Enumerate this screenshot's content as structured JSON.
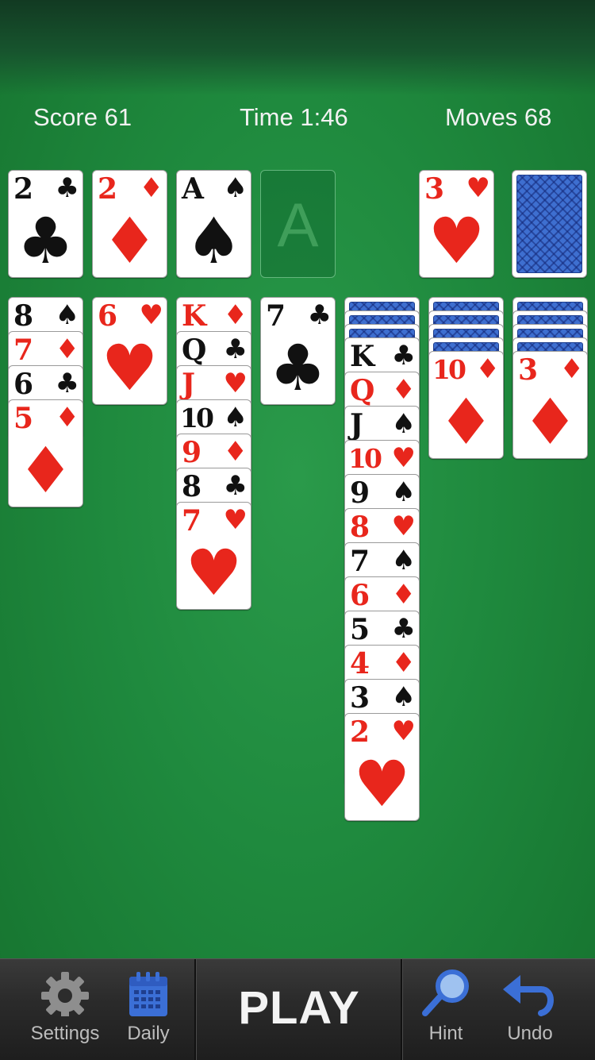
{
  "stats": {
    "score": "Score 61",
    "time": "Time 1:46",
    "moves": "Moves 68"
  },
  "foundations": [
    {
      "rank": "2",
      "suit": "♣",
      "color": "black"
    },
    {
      "rank": "2",
      "suit": "♦",
      "color": "red"
    },
    {
      "rank": "A",
      "suit": "♠",
      "color": "black"
    },
    {
      "empty": true,
      "placeholder": "A"
    }
  ],
  "waste": {
    "rank": "3",
    "suit": "♥",
    "color": "red"
  },
  "stock": {
    "face_down": true
  },
  "tableau": [
    {
      "hidden": 0,
      "cards": [
        {
          "rank": "8",
          "suit": "♠",
          "color": "black"
        },
        {
          "rank": "7",
          "suit": "♦",
          "color": "red"
        },
        {
          "rank": "6",
          "suit": "♣",
          "color": "black"
        },
        {
          "rank": "5",
          "suit": "♦",
          "color": "red"
        }
      ]
    },
    {
      "hidden": 0,
      "cards": [
        {
          "rank": "6",
          "suit": "♥",
          "color": "red"
        }
      ]
    },
    {
      "hidden": 0,
      "cards": [
        {
          "rank": "K",
          "suit": "♦",
          "color": "red"
        },
        {
          "rank": "Q",
          "suit": "♣",
          "color": "black"
        },
        {
          "rank": "J",
          "suit": "♥",
          "color": "red"
        },
        {
          "rank": "10",
          "suit": "♠",
          "color": "black"
        },
        {
          "rank": "9",
          "suit": "♦",
          "color": "red"
        },
        {
          "rank": "8",
          "suit": "♣",
          "color": "black"
        },
        {
          "rank": "7",
          "suit": "♥",
          "color": "red"
        }
      ]
    },
    {
      "hidden": 0,
      "cards": [
        {
          "rank": "7",
          "suit": "♣",
          "color": "black"
        }
      ]
    },
    {
      "hidden": 3,
      "cards": [
        {
          "rank": "K",
          "suit": "♣",
          "color": "black"
        },
        {
          "rank": "Q",
          "suit": "♦",
          "color": "red"
        },
        {
          "rank": "J",
          "suit": "♠",
          "color": "black"
        },
        {
          "rank": "10",
          "suit": "♥",
          "color": "red"
        },
        {
          "rank": "9",
          "suit": "♠",
          "color": "black"
        },
        {
          "rank": "8",
          "suit": "♥",
          "color": "red"
        },
        {
          "rank": "7",
          "suit": "♠",
          "color": "black"
        },
        {
          "rank": "6",
          "suit": "♦",
          "color": "red"
        },
        {
          "rank": "5",
          "suit": "♣",
          "color": "black"
        },
        {
          "rank": "4",
          "suit": "♦",
          "color": "red"
        },
        {
          "rank": "3",
          "suit": "♠",
          "color": "black"
        },
        {
          "rank": "2",
          "suit": "♥",
          "color": "red"
        }
      ]
    },
    {
      "hidden": 4,
      "cards": [
        {
          "rank": "10",
          "suit": "♦",
          "color": "red"
        }
      ]
    },
    {
      "hidden": 4,
      "cards": [
        {
          "rank": "3",
          "suit": "♦",
          "color": "red"
        }
      ]
    }
  ],
  "toolbar": {
    "settings_label": "Settings",
    "daily_label": "Daily",
    "play_label": "PLAY",
    "hint_label": "Hint",
    "undo_label": "Undo"
  },
  "icons": {
    "settings": "gear-icon",
    "daily": "calendar-icon",
    "hint": "magnifier-icon",
    "undo": "undo-arrow-icon"
  },
  "colors": {
    "felt": "#1f8a3e",
    "red_suit": "#e8261c",
    "black_suit": "#111111",
    "card_back": "#3e6fd0",
    "icon_blue": "#3b6fd6"
  }
}
